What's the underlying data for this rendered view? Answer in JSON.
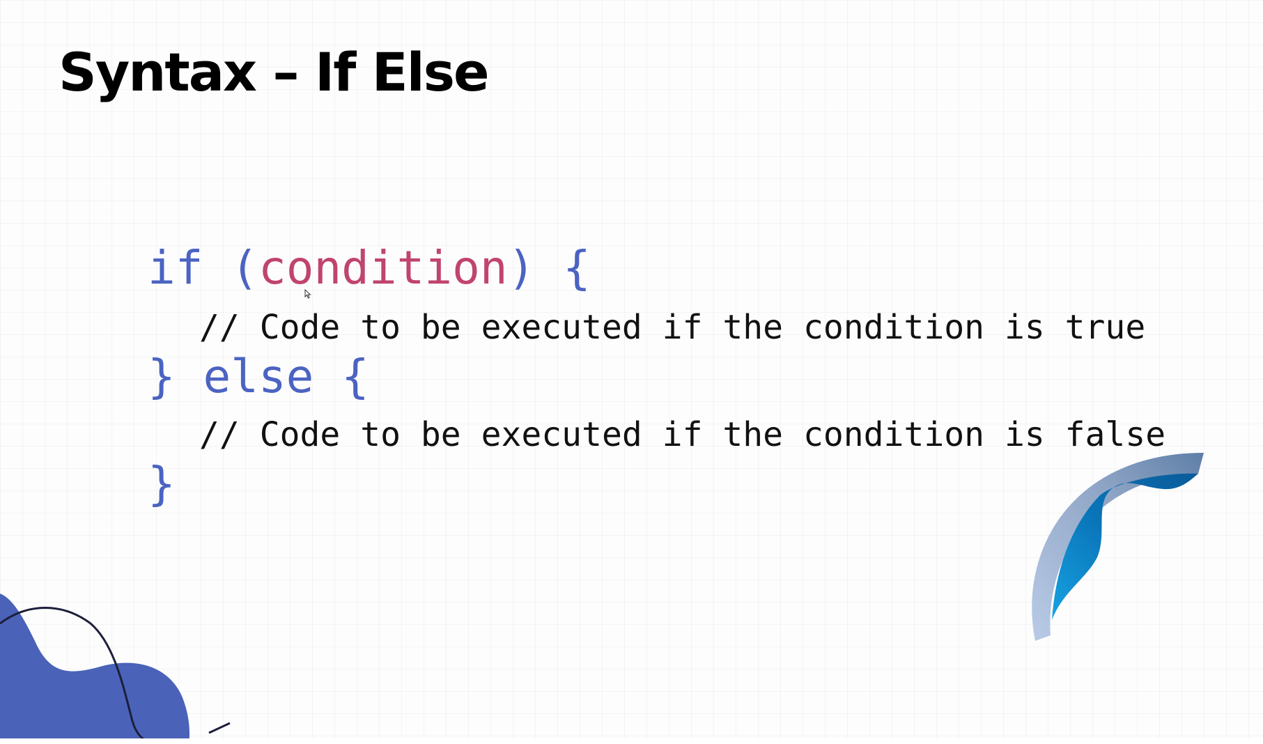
{
  "slide": {
    "title": "Syntax – If Else"
  },
  "code": {
    "if_keyword": "if",
    "if_open_paren": " (",
    "condition": "condition",
    "if_close_paren_brace": ") {",
    "comment_true": "// Code to be executed if the condition is true",
    "else_line": "} else {",
    "comment_false": "// Code to be executed if the condition is false",
    "closing_brace": "}"
  },
  "colors": {
    "keyword": "#4b63c2",
    "condition": "#c0446e",
    "comment": "#111111",
    "title": "#000000",
    "deco_blue": "#4a62b8",
    "deco_cyan": "#0a86c9"
  },
  "icons": {
    "cursor": "mouse-pointer-icon"
  }
}
